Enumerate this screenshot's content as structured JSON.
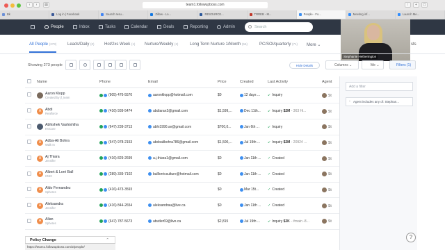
{
  "browser": {
    "url": "team1.followupboss.com",
    "tabs": [
      "Bk",
      "Log in | Facebook",
      "Search resu...",
      "Zillow - Lo...",
      "RESOURCE...",
      "TRREB - M...",
      "People - Fo...",
      "Meeting inf...",
      "Launch Me..."
    ],
    "active_tab_index": 6
  },
  "nav": {
    "items": [
      {
        "label": "People",
        "active": true
      },
      {
        "label": "Inbox",
        "active": false
      },
      {
        "label": "Tasks",
        "active": false
      },
      {
        "label": "Calendar",
        "active": false
      },
      {
        "label": "Deals",
        "active": false
      },
      {
        "label": "Reporting",
        "active": false
      },
      {
        "label": "Admin",
        "active": false
      }
    ],
    "search_placeholder": "Search"
  },
  "video": {
    "name": "Stephanie Hetherington"
  },
  "filter_tabs": [
    {
      "label": "All People",
      "count": "(273)",
      "active": true
    },
    {
      "label": "Leads/Daily",
      "count": "(0)",
      "active": false
    },
    {
      "label": "Hot/2xs Week",
      "count": "(1)",
      "active": false
    },
    {
      "label": "Nurture/Weekly",
      "count": "(2)",
      "active": false
    },
    {
      "label": "Long Term Nurture 1/Month",
      "count": "(56)",
      "active": false
    },
    {
      "label": "PC/SOI/quarterly",
      "count": "(71)",
      "active": false
    },
    {
      "label": "More",
      "count": "",
      "active": false
    }
  ],
  "filter_tabs_trail": "sts",
  "toolbar": {
    "showing": "Showing 273 people",
    "hide_details": "Hide Details",
    "columns": "Columns",
    "me": "Me",
    "filters": "Filters (1)"
  },
  "sidebar": {
    "add_filter": "Add a filter",
    "chip": "Agent includes any of: Stephan..."
  },
  "table": {
    "headers": [
      "Name",
      "Phone",
      "Email",
      "Price",
      "Created",
      "Last Activity",
      "Agent"
    ],
    "rows": [
      {
        "name": "Aaron Klopp",
        "sub": "Created by jf_team",
        "avatar": "photo",
        "avatar_color": "#7a6a5c",
        "phone": "(905) 476-5570",
        "email": "aaronklopp@hotmail.com",
        "price": "$0",
        "created": "12 days ...",
        "activity_pre": "Inquiry",
        "activity_bold": "",
        "activity_post": "",
        "agent": "St"
      },
      {
        "name": "Abdi",
        "sub": "Realforce",
        "avatar": "A",
        "avatar_color": "#f08d4a",
        "phone": "(416) 939-5474",
        "email": "abdiaran2@gmail.com",
        "price": "$1,599,...",
        "created": "Dec 11th...",
        "activity_pre": "Inquiry",
        "activity_bold": "$2M",
        "activity_post": "- 363 Hi...",
        "agent": "St"
      },
      {
        "name": "Abhishek Vashishtha",
        "sub": "KVCore",
        "avatar": "photo",
        "avatar_color": "#4b5a6e",
        "phone": "(647) 239-3713",
        "email": "abhi1990.av@gmail.com",
        "price": "$700,0...",
        "created": "Jan 6th ...",
        "activity_pre": "Inquiry",
        "activity_bold": "",
        "activity_post": "",
        "agent": "St"
      },
      {
        "name": "Adba-Ali Bohra",
        "sub": "Walk In",
        "avatar": "A",
        "avatar_color": "#f08d4a",
        "phone": "(647) 978-2153",
        "email": "abdoalibohra786@gmail.com",
        "price": "$1,500,...",
        "created": "Jul 19th ...",
        "activity_pre": "Inquiry",
        "activity_bold": "$2M",
        "activity_post": "- 20924 ...",
        "agent": "St"
      },
      {
        "name": "Aj Thiara",
        "sub": "Jennifer",
        "avatar": "A",
        "avatar_color": "#f08d4a",
        "phone": "(416) 829-2699",
        "email": "a.j.thiara1@gmail.com",
        "price": "$0",
        "created": "Jan 11th ...",
        "activity_pre": "Created",
        "activity_bold": "",
        "activity_post": "",
        "agent": "St"
      },
      {
        "name": "Albert & Lorri Ball",
        "sub": "CNIC",
        "avatar": "A",
        "avatar_color": "#f08d4a",
        "phone": "(289) 339-7102",
        "email": "balllorricsulture@hotmail.com",
        "price": "$0",
        "created": "Jan 11th ...",
        "activity_pre": "Created",
        "activity_bold": "",
        "activity_post": "",
        "agent": "St"
      },
      {
        "name": "Aldo Fernandez",
        "sub": "Spheres",
        "avatar": "A",
        "avatar_color": "#f08d4a",
        "phone": "(416) 473-3593",
        "email": "",
        "price": "$0",
        "created": "Mar 15t...",
        "activity_pre": "Created",
        "activity_bold": "",
        "activity_post": "",
        "agent": "St"
      },
      {
        "name": "Aleksandra",
        "sub": "Jennifer",
        "avatar": "A",
        "avatar_color": "#f08d4a",
        "phone": "(416) 844-2654",
        "email": "aleksandrau@live.ca",
        "price": "$0",
        "created": "Jan 11th ...",
        "activity_pre": "Created",
        "activity_bold": "",
        "activity_post": "",
        "agent": "St"
      },
      {
        "name": "Allan",
        "sub": "Spheres",
        "avatar": "A",
        "avatar_color": "#f08d4a",
        "phone": "(647) 787-5673",
        "email": "abutler69@live.ca",
        "price": "$2,815",
        "created": "Jul 19th ...",
        "activity_pre": "Inquiry",
        "activity_bold": "$2K",
        "activity_post": "- #main -8...",
        "agent": "St"
      }
    ]
  },
  "status_url": "https://team1.followupboss.com/2/people/",
  "policy": "Policy Change",
  "help_glyph": "?"
}
